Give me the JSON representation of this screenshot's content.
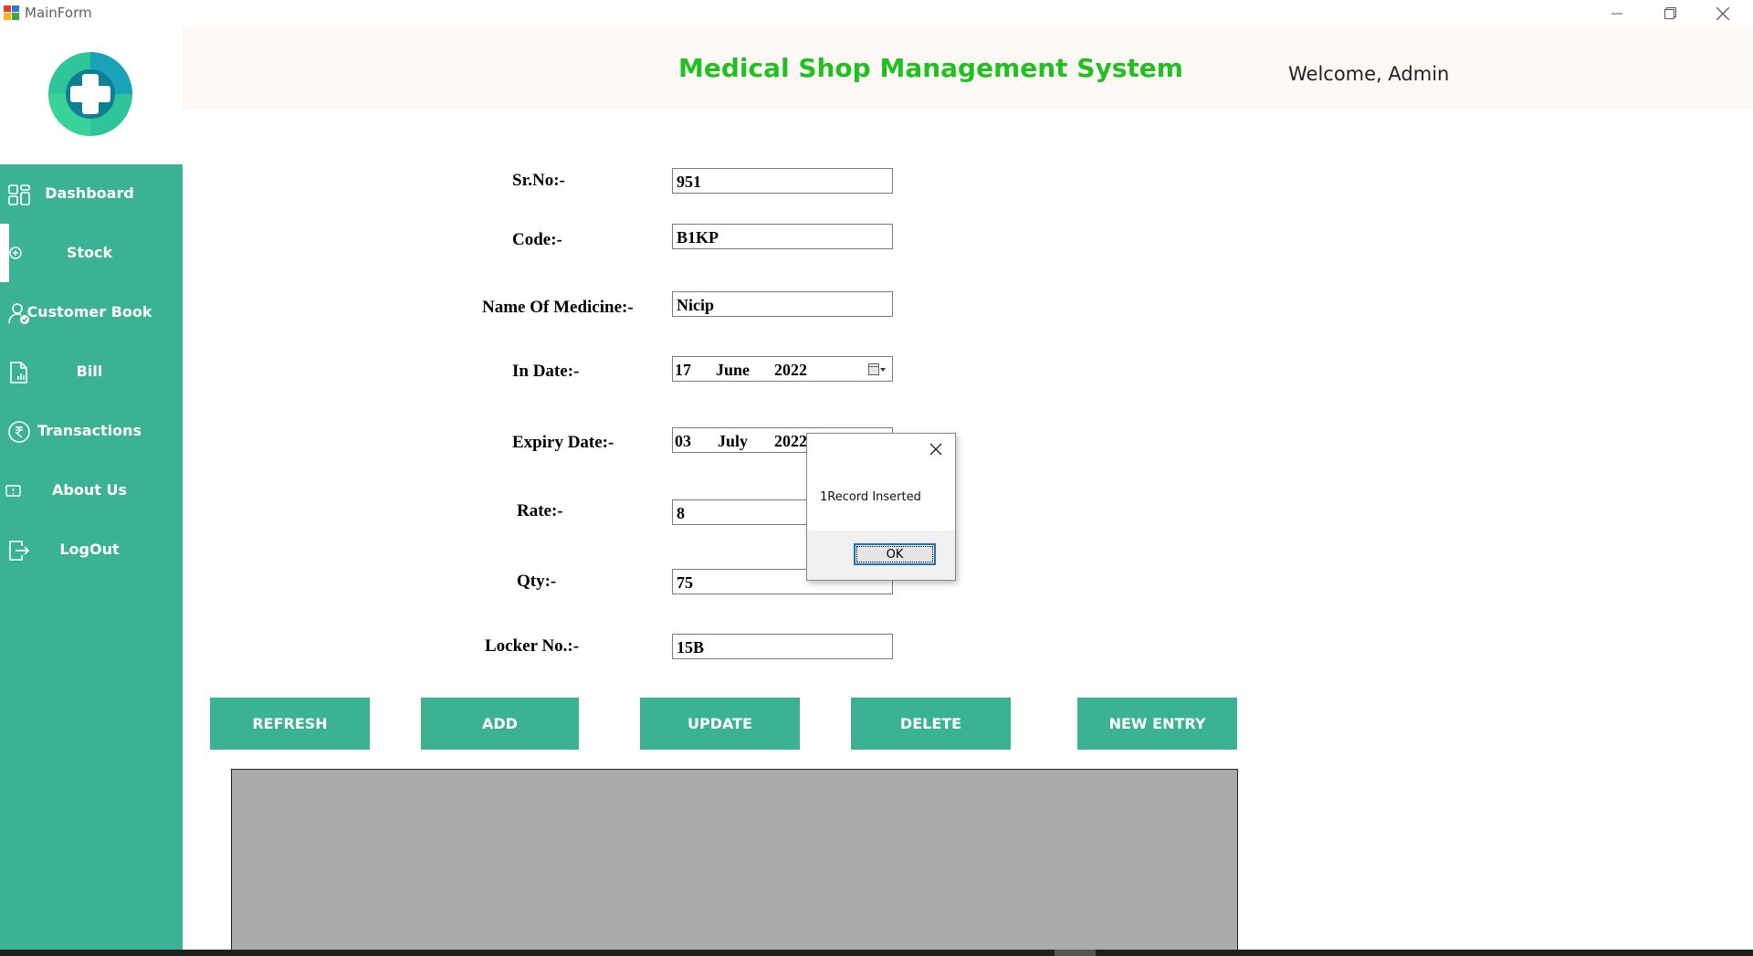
{
  "window": {
    "title": "MainForm"
  },
  "header": {
    "title": "Medical Shop Management System",
    "welcome": "Welcome, Admin"
  },
  "sidebar": {
    "active": "Stock",
    "items": [
      {
        "label": "Dashboard",
        "icon": "dashboard-icon"
      },
      {
        "label": "Stock",
        "icon": "plus-circle-icon"
      },
      {
        "label": "Customer Book",
        "icon": "user-check-icon"
      },
      {
        "label": "Bill",
        "icon": "bill-icon"
      },
      {
        "label": "Transactions",
        "icon": "rupee-icon"
      },
      {
        "label": "About Us",
        "icon": "info-icon"
      },
      {
        "label": "LogOut",
        "icon": "logout-icon"
      }
    ]
  },
  "form": {
    "srno": {
      "label": "Sr.No:-",
      "value": "951"
    },
    "code": {
      "label": "Code:-",
      "value": "B1KP"
    },
    "name": {
      "label": "Name Of Medicine:-",
      "value": "Nicip"
    },
    "in_date": {
      "label": "In Date:-",
      "day": "17",
      "month": "June",
      "year": "2022"
    },
    "expiry_date": {
      "label": "Expiry Date:-",
      "day": "03",
      "month": "July",
      "year": "2022"
    },
    "rate": {
      "label": "Rate:-",
      "value": "8"
    },
    "qty": {
      "label": "Qty:-",
      "value": "75"
    },
    "locker": {
      "label": "Locker No.:-",
      "value": "15B"
    }
  },
  "buttons": {
    "refresh": "REFRESH",
    "add": "ADD",
    "update": "UPDATE",
    "delete": "DELETE",
    "new_entry": "NEW ENTRY"
  },
  "dialog": {
    "message": "1Record Inserted",
    "ok": "OK"
  },
  "colors": {
    "accent": "#3bb293",
    "title": "#1fc01f",
    "header_bg": "#fdf7f6",
    "grid_bg": "#ababab"
  }
}
